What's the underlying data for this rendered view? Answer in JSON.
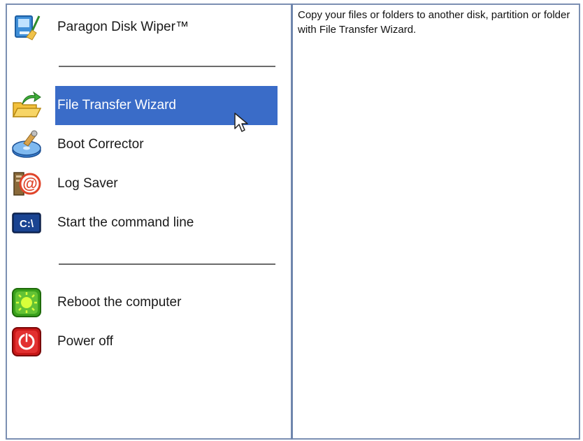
{
  "menu": {
    "title_item": {
      "label": "Paragon Disk Wiper™",
      "icon": "disk-wiper-icon"
    },
    "items": [
      {
        "label": "File Transfer Wizard",
        "icon": "folder-arrow-icon",
        "selected": true
      },
      {
        "label": "Boot Corrector",
        "icon": "boot-disk-icon",
        "selected": false
      },
      {
        "label": "Log Saver",
        "icon": "log-saver-icon",
        "selected": false
      },
      {
        "label": "Start the command line",
        "icon": "command-line-icon",
        "icon_text": "C:\\",
        "selected": false
      }
    ],
    "power_items": [
      {
        "label": "Reboot the computer",
        "icon": "reboot-icon"
      },
      {
        "label": "Power off",
        "icon": "power-icon"
      }
    ]
  },
  "description": {
    "text": "Copy your files or folders to another disk, partition or folder with File Transfer Wizard."
  },
  "colors": {
    "highlight": "#3a6cc8",
    "border": "#6f86ad",
    "separator": "#6b6b6b"
  }
}
